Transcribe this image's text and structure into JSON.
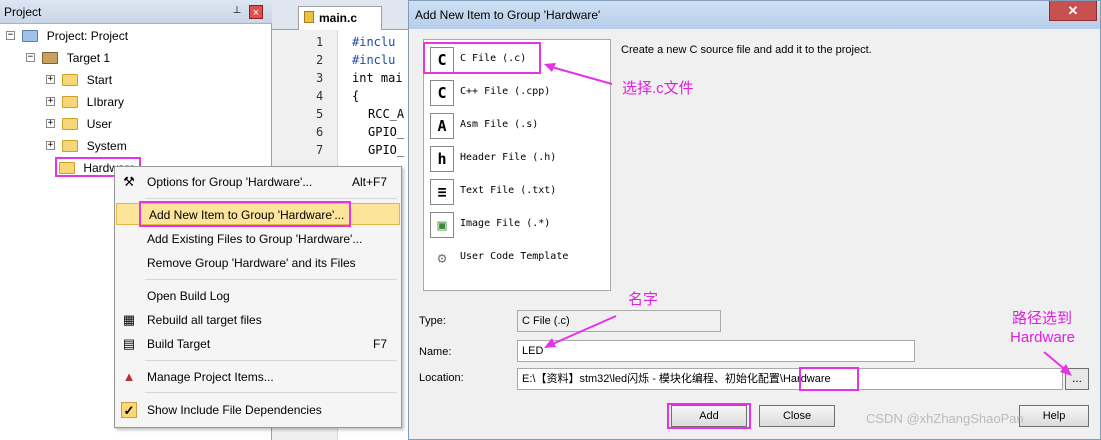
{
  "project_panel": {
    "title": "Project",
    "pin_glyph": "⊥",
    "close_glyph": "×",
    "tree": [
      {
        "label": "Project: Project",
        "expander": "−",
        "indent": 0
      },
      {
        "label": "Target 1",
        "expander": "−",
        "indent": 1
      },
      {
        "label": "Start",
        "expander": "+",
        "indent": 2
      },
      {
        "label": "LIbrary",
        "expander": "+",
        "indent": 2
      },
      {
        "label": "User",
        "expander": "+",
        "indent": 2
      },
      {
        "label": "System",
        "expander": "+",
        "indent": 2
      },
      {
        "label": "Hardware",
        "expander": "",
        "indent": 2
      }
    ]
  },
  "editor": {
    "tab_label": "main.c",
    "lines": [
      {
        "no": "1",
        "code": "#inclu"
      },
      {
        "no": "2",
        "code": "#inclu"
      },
      {
        "no": "3",
        "code": "int mai"
      },
      {
        "no": "4",
        "code": "{"
      },
      {
        "no": "5",
        "code": "RCC_A"
      },
      {
        "no": "6",
        "code": "GPIO_"
      },
      {
        "no": "7",
        "code": "GPIO_"
      }
    ]
  },
  "context_menu": {
    "items": [
      {
        "label": "Options for Group 'Hardware'...",
        "shortcut": "Alt+F7",
        "icon": "wand-icon"
      },
      {
        "label": "Add New  Item to Group 'Hardware'...",
        "shortcut": "",
        "icon": ""
      },
      {
        "label": "Add Existing Files to Group 'Hardware'...",
        "shortcut": "",
        "icon": ""
      },
      {
        "label": "Remove Group 'Hardware' and its Files",
        "shortcut": "",
        "icon": ""
      },
      {
        "label": "Open Build Log",
        "shortcut": "",
        "icon": ""
      },
      {
        "label": "Rebuild all target files",
        "shortcut": "",
        "icon": "rebuild-icon"
      },
      {
        "label": "Build Target",
        "shortcut": "F7",
        "icon": "build-icon"
      },
      {
        "label": "Manage Project Items...",
        "shortcut": "",
        "icon": "manage-icon"
      },
      {
        "label": "Show Include File Dependencies",
        "shortcut": "",
        "icon": "check-icon"
      }
    ]
  },
  "dialog": {
    "title": "Add New Item to Group 'Hardware'",
    "close_glyph": "✕",
    "description": "Create a new C source file and add it to the project.",
    "item_types": [
      {
        "icon_text": "C",
        "label": "C File (.c)"
      },
      {
        "icon_text": "C",
        "label": "C++ File (.cpp)"
      },
      {
        "icon_text": "A",
        "label": "Asm File (.s)"
      },
      {
        "icon_text": "h",
        "label": "Header File (.h)"
      },
      {
        "icon_text": "≡",
        "label": "Text File (.txt)"
      },
      {
        "icon_text": "▣",
        "label": "Image File (.*)"
      },
      {
        "icon_text": "⚙",
        "label": "User Code Template"
      }
    ],
    "type_label": "Type:",
    "type_value": "C File (.c)",
    "name_label": "Name:",
    "name_value": "LED",
    "location_label": "Location:",
    "location_value": "E:\\【资料】stm32\\led闪烁 - 模块化编程、初始化配置\\Hardware",
    "browse_label": "...",
    "add_label": "Add",
    "close_label": "Close",
    "help_label": "Help"
  },
  "annotations": {
    "select_c": "选择.c文件",
    "name": "名字",
    "path_line1": "路径选到",
    "path_line2": "Hardware",
    "color": "#e633e6"
  },
  "watermark": "CSDN @xhZhangShaoPan"
}
